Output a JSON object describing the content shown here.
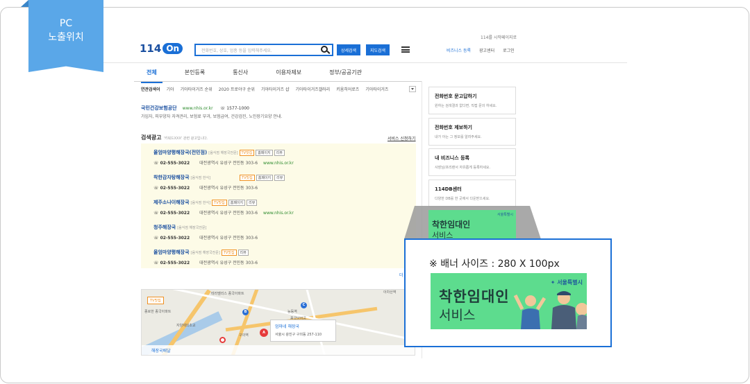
{
  "ribbon": {
    "line1": "PC",
    "line2": "노출위치"
  },
  "header": {
    "logo_text": "114",
    "logo_badge": "On",
    "top_link": "114를 시작페이지로",
    "search_placeholder": "전화번호, 상호, 업종 등을 입력해주세요.",
    "detail_search": "상세검색",
    "map_search": "지도검색",
    "links": [
      "비즈니스 등록",
      "광고센터",
      "로그인"
    ]
  },
  "gnb": [
    "전체",
    "본인등록",
    "통신사",
    "이용자제보",
    "정부/공공기관"
  ],
  "related": {
    "label": "연관검색어",
    "items": [
      "기아",
      "기아타이거즈 순위",
      "2020 프로야구 순위",
      "기아타이거즈 샵",
      "기아타이거즈갤러리",
      "키움히어로즈",
      "기아타이거즈"
    ]
  },
  "top_ad": {
    "name": "국민건강보험공단",
    "url": "www.nhis.or.kr",
    "tel": "1577-1000",
    "desc": "가입자, 피부양자 자격관리, 보험료 부과, 보험급여, 건강검진, 노인장기요양 안내."
  },
  "search_ads": {
    "title": "검색광고",
    "subtitle": "'키워드XXX' 관련 광고입니다.",
    "apply": "서비스 신청하기",
    "more": "더",
    "items": [
      {
        "name": "올엄마양평해장국(전민점)",
        "cat": "[음식점 해장국전문]",
        "tags": [
          "TV맛집",
          "홈페이지",
          "리뷰"
        ],
        "phone": "02-555-3022",
        "addr": "대전광역시 유성구 전민동 303-6",
        "url": "www.nhis.or.kr"
      },
      {
        "name": "착한감자탕해장국",
        "cat": "[음식점 한식]",
        "tags": [
          "TV맛집",
          "홈페이지",
          "리뷰"
        ],
        "phone": "02-555-3022",
        "addr": "대전광역시 유성구 전민동 303-6",
        "url": ""
      },
      {
        "name": "제주소나이해장국",
        "cat": "[음식점 한식]",
        "tags": [
          "TV맛집",
          "홈페이지",
          "리뷰"
        ],
        "phone": "02-555-3022",
        "addr": "대전광역시 유성구 전민동 303-6",
        "url": "www.nhis.or.kr"
      },
      {
        "name": "청주해장국",
        "cat": "[음식점 해장국전문]",
        "tags": [],
        "phone": "02-555-3022",
        "addr": "대전광역시 유성구 전민동 303-6",
        "url": ""
      },
      {
        "name": "올엄마양평해장국",
        "cat": "[음식점 해장국전문]",
        "tags": [
          "TV맛집",
          "리뷰"
        ],
        "phone": "02-555-3022",
        "addr": "대전광역시 유성구 전민동 303-6",
        "url": ""
      }
    ]
  },
  "map": {
    "badge": "TV맛집",
    "popup_title": "엄마네 해장국",
    "popup_addr": "서울시 광진구 구의동 257-110",
    "footer": "해장국배달",
    "labels": [
      "테라벨리스 종국아파트",
      "종로한 종국아파트",
      "자양제외초교",
      "구의역",
      "능동역",
      "종국남자공",
      "아차산역"
    ]
  },
  "side_cards": [
    {
      "title": "전화번호 문고답하기",
      "desc": "원하는 검색결과 없다면, 직접 문의 하세요."
    },
    {
      "title": "전화번호 제보하기",
      "desc": "내가 아는 그 정보를 알려주세요."
    },
    {
      "title": "내 비즈니스 등록",
      "desc": "사장님/프리랜서 자유롭게 등록하세요."
    },
    {
      "title": "114DB센터",
      "desc": "다양한 DB를 한 곳에서 다운받으세요."
    }
  ],
  "banner": {
    "caption_mark": "※",
    "caption_text": "배너 사이즈 : 280 X 100px",
    "line1": "착한임대인",
    "line2": "서비스",
    "org": "서울특별시"
  }
}
